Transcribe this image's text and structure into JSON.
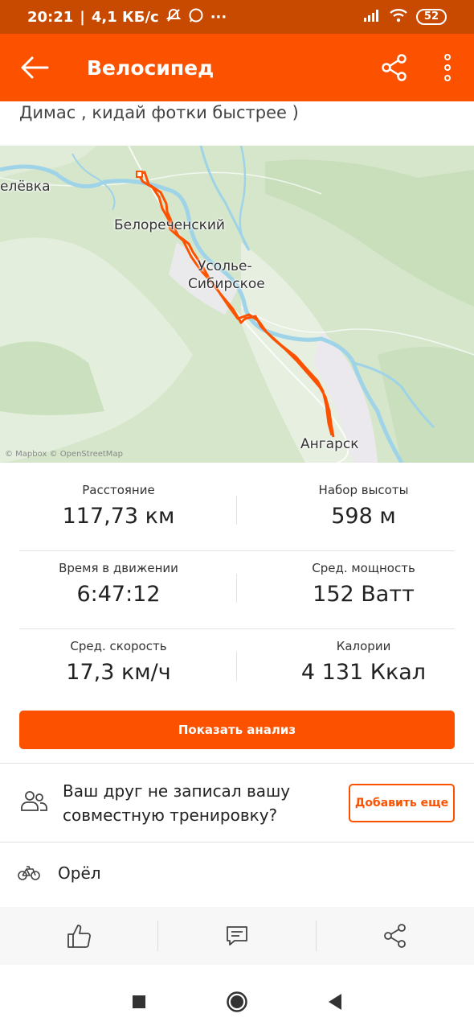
{
  "status_bar": {
    "time": "20:21",
    "network_speed": "4,1 КБ/с",
    "battery": "52"
  },
  "app_bar": {
    "title": "Велосипед"
  },
  "activity": {
    "description": "Димас , кидай фотки быстрее )"
  },
  "map": {
    "labels": {
      "elevka": "елёвка",
      "belorechensky": "Белореченский",
      "usolye_1": "Усолье-",
      "usolye_2": "Сибирское",
      "angarsk": "Ангарск"
    },
    "attribution": "© Mapbox © OpenStreetMap",
    "route_color": "#fc5200",
    "river_color": "#9fd3e8"
  },
  "stats": [
    {
      "left_label": "Расстояние",
      "left_value": "117,73 км",
      "right_label": "Набор высоты",
      "right_value": "598 м"
    },
    {
      "left_label": "Время в движении",
      "left_value": "6:47:12",
      "right_label": "Сред. мощность",
      "right_value": "152 Ватт"
    },
    {
      "left_label": "Сред. скорость",
      "left_value": "17,3 км/ч",
      "right_label": "Калории",
      "right_value": "4 131 Ккал"
    }
  ],
  "analyze_button": "Показать анализ",
  "friend_prompt": {
    "text": "Ваш друг не записал вашу совместную тренировку?",
    "button": "Добавить еще"
  },
  "gear": {
    "name": "Орёл"
  },
  "colors": {
    "accent": "#fc5200",
    "status_bar": "#c84a00"
  }
}
